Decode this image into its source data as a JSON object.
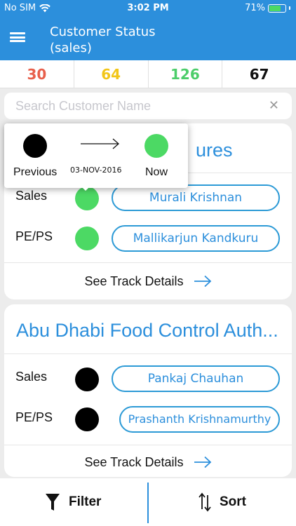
{
  "status_bar": {
    "carrier": "No SIM",
    "time": "3:02 PM",
    "battery": "71%",
    "battery_level": 0.71
  },
  "header": {
    "title_line1": "Customer Status",
    "title_line2": "(sales)"
  },
  "counts": [
    {
      "value": "30",
      "color": "#e8604c"
    },
    {
      "value": "64",
      "color": "#f2c619"
    },
    {
      "value": "126",
      "color": "#4ccd6a"
    },
    {
      "value": "67",
      "color": "#111111"
    }
  ],
  "search": {
    "placeholder": "Search Customer Name",
    "value": ""
  },
  "colors": {
    "accent": "#2c8fdc",
    "green": "#4cd964",
    "black": "#000000"
  },
  "cards": [
    {
      "title": "ures",
      "rows": [
        {
          "label": "Sales",
          "status": "green",
          "person": "Murali Krishnan"
        },
        {
          "label": "PE/PS",
          "status": "green",
          "person": "Mallikarjun Kandkuru"
        }
      ],
      "see_track": "See Track Details"
    },
    {
      "title": "Abu Dhabi Food Control Auth...",
      "rows": [
        {
          "label": "Sales",
          "status": "black",
          "person": "Pankaj Chauhan"
        },
        {
          "label": "PE/PS",
          "status": "black",
          "person": "Prashanth Krishnamurthy"
        }
      ],
      "see_track": "See Track Details"
    }
  ],
  "popup": {
    "previous_label": "Previous",
    "now_label": "Now",
    "date": "03-NOV-2016",
    "previous_status": "black",
    "now_status": "green"
  },
  "bottom_bar": {
    "filter_label": "Filter",
    "sort_label": "Sort"
  }
}
